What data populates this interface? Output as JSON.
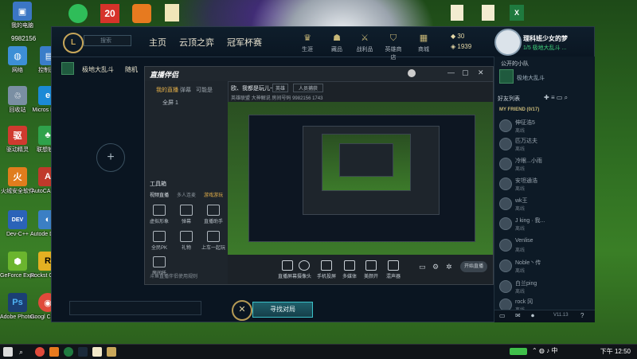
{
  "desktop": {
    "icons": [
      {
        "label": "我的电脑",
        "glyph": "▣",
        "color": "#3b76c4"
      },
      {
        "label": "9982156",
        "glyph": "",
        "color": ""
      },
      {
        "label": "网络",
        "glyph": "◍",
        "color": "#3d8fd6"
      },
      {
        "label": "回收站",
        "glyph": "♲",
        "color": "#7a8fa3"
      },
      {
        "label": "驱动精灵",
        "glyph": "驱",
        "color": "#d03a2f"
      },
      {
        "label": "火绒安全软件",
        "glyph": "火",
        "color": "#e07d1d"
      },
      {
        "label": "Dev-C++",
        "glyph": "DEV",
        "color": "#2b63b8"
      },
      {
        "label": "GeForce Experience",
        "glyph": "⬢",
        "color": "#6bb52e"
      },
      {
        "label": "Adobe Photosh...",
        "glyph": "Ps",
        "color": "#1b3f73"
      },
      {
        "label": "控制面板",
        "glyph": "▤",
        "color": "#3a7dc9"
      },
      {
        "label": "Micros Edge",
        "glyph": "e",
        "color": "#1b8ad6"
      },
      {
        "label": "联想软件",
        "glyph": "♣",
        "color": "#2fa24b"
      },
      {
        "label": "AutoCA 2007",
        "glyph": "A",
        "color": "#c0392b"
      },
      {
        "label": "Autode DWF Vi",
        "glyph": "◐",
        "color": "#3b7fc4"
      },
      {
        "label": "Rockst Games",
        "glyph": "R",
        "color": "#e3b022"
      },
      {
        "label": "Googl Chrome",
        "glyph": "◉",
        "color": "#e04a3b"
      },
      {
        "label": "腾讯网",
        "glyph": "Q",
        "color": "#1d7dd8"
      }
    ]
  },
  "client": {
    "search_placeholder": "搜索",
    "nav": [
      "主页",
      "云顶之弈",
      "冠军杯赛"
    ],
    "top_icons": [
      "生涯",
      "藏品",
      "战利品",
      "英雄商店",
      "商城"
    ],
    "currency": {
      "be": "30",
      "rp": "1939"
    },
    "profile": {
      "name": "理科班少女的梦",
      "status": "1/5 极地大乱斗 ..."
    },
    "mode": {
      "title": "极地大乱斗",
      "subtitle": "随机"
    },
    "find_match": "寻找对局",
    "party_label": "公开的小队",
    "party_sub": "极地大乱斗",
    "friends_title": "好友列表",
    "friends_group": "MY FRIEND (0/17)",
    "friends": [
      {
        "name": "伸征浩5",
        "status": "离线"
      },
      {
        "name": "匹万达夫",
        "status": "离线"
      },
      {
        "name": "冷眼...小雨",
        "status": "离线"
      },
      {
        "name": "安坦通浩",
        "status": "离线"
      },
      {
        "name": "wk王",
        "status": "离线"
      },
      {
        "name": "J king · 我...",
        "status": "离线"
      },
      {
        "name": "Venlise",
        "status": "离线"
      },
      {
        "name": "Noble丶传",
        "status": "离线"
      },
      {
        "name": "白兰ping",
        "status": "离线"
      },
      {
        "name": "rock 冈",
        "status": "离线"
      }
    ],
    "version": "V11.13"
  },
  "stream": {
    "title": "直播伴侣",
    "tabs": [
      "我的直播",
      "弹幕",
      "可能是"
    ],
    "scene": "全屏 1",
    "username": "欧、我都是玩儿~",
    "tag": "英雄",
    "add_tag": "人员捕获",
    "subinfo": [
      "英雄联盟",
      "大神解说",
      "房间号码",
      "9982156",
      "1743"
    ],
    "toolbox": "工具箱",
    "toolbox_tabs": [
      "视频直播",
      "多人连麦",
      "游戏游玩"
    ],
    "tools": [
      "虚拟形象",
      "弹幕",
      "直播助手",
      "全民PK",
      "礼物",
      "上车一起玩",
      "房间托"
    ],
    "bottom_tools": [
      "直播屏幕",
      "摄像头",
      "手机投屏",
      "多媒体",
      "美颜开",
      "混声器"
    ],
    "start_button": "开始直播",
    "footer": "斗鱼直播伴侣使用规则"
  },
  "taskbar": {
    "time": "下午 12:50"
  }
}
